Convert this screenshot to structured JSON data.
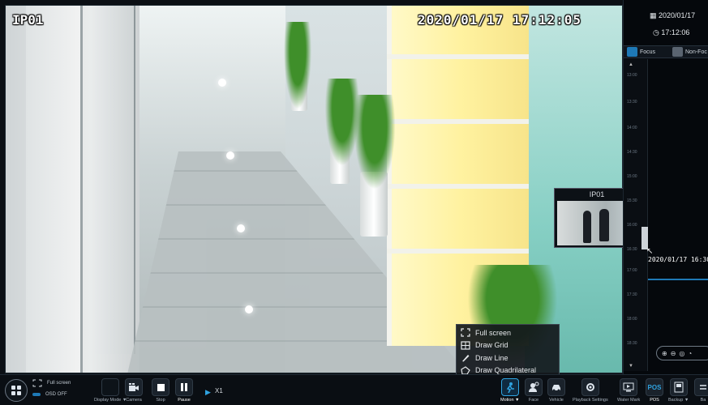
{
  "video": {
    "channel": "IP01",
    "timestamp": "2020/01/17 17:12:05"
  },
  "preview": {
    "title": "IP01"
  },
  "context_menu": {
    "items": [
      "Full screen",
      "Draw Grid",
      "Draw Line",
      "Draw Quadrilateral"
    ]
  },
  "right_panel": {
    "date": "2020/01/17",
    "time": "17:12:06",
    "tabs": [
      "Focus",
      "Non-Foc"
    ],
    "timeline_ticks": [
      "13:00",
      "13:30",
      "14:00",
      "14:30",
      "15:00",
      "15:30",
      "16:00",
      "16:30",
      "17:00",
      "17:30",
      "18:00",
      "18:30"
    ],
    "cursor_time": "2020/01/17 16:30:"
  },
  "toolbar": {
    "full_screen": "Full screen",
    "osd_off": "OSD OFF",
    "display_mode": "Display Mode",
    "camera": "Camera",
    "stop": "Stop",
    "pause": "Pause",
    "speed": "X1",
    "motion": "Motion",
    "face": "Face",
    "vehicle": "Vehicle",
    "playback_settings": "Playback Settings",
    "water_mark": "Water Mark",
    "pos": "POS",
    "backup": "Backup",
    "back": "Ba",
    "pos_icon_text": "POS"
  },
  "colors": {
    "accent": "#2fa3e0",
    "panel_bg": "#05080c",
    "toolbar_bg": "#0a0e13"
  }
}
